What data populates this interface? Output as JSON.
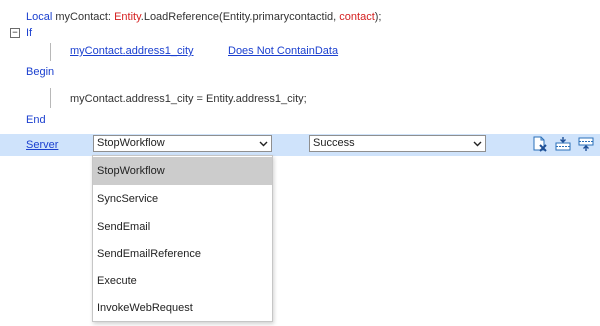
{
  "code": {
    "line1": {
      "kw_local": "Local",
      "var": "myContact:",
      "entity": "Entity",
      "call": ".LoadReference(Entity.primarycontactid,",
      "arg": "contact",
      "close": ");"
    },
    "if_kw": "If",
    "condition": {
      "field_obj": "myContact",
      "field_dot": ".",
      "field_attr": "address1_city",
      "operator": "Does Not ContainData"
    },
    "begin_kw": "Begin",
    "assignment": "myContact.address1_city = Entity.address1_city;",
    "end_kw": "End",
    "collapse_symbol": "−"
  },
  "server_row": {
    "label": "Server",
    "action_select": "StopWorkflow",
    "status_select": "Success",
    "icons": [
      "delete-file-icon",
      "insert-row-below-icon",
      "insert-row-above-icon"
    ],
    "row_color": "#cfe3fb"
  },
  "dropdown": {
    "options": [
      "StopWorkflow",
      "SyncService",
      "SendEmail",
      "SendEmailReference",
      "Execute",
      "InvokeWebRequest"
    ],
    "selected": "StopWorkflow"
  },
  "colors": {
    "keyword": "#1a3fcf",
    "entity": "#d41f1f",
    "link": "#1a3fcf",
    "selected_option": "#cccccc"
  }
}
